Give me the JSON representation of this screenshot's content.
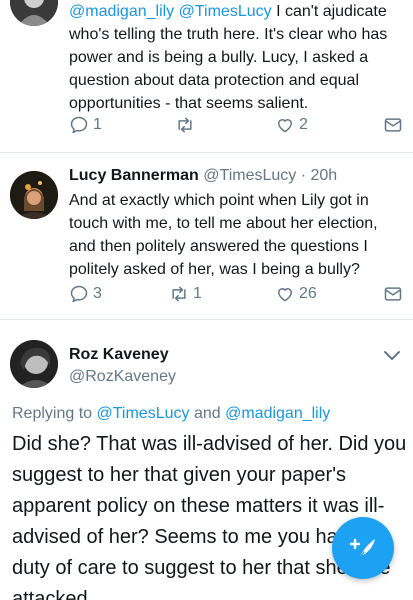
{
  "tweets": [
    {
      "mentions": "@madigan_lily @TimesLucy",
      "text": " I can't ajudicate who's telling the truth here. It's clear who has power and is being a bully. Lucy, I asked a question about data protection and equal opportunities - that seems salient.",
      "reply_count": "1",
      "retweet_count": "",
      "like_count": "2"
    },
    {
      "name": "Lucy Bannerman",
      "handle": "@TimesLucy",
      "separator": "·",
      "time": "20h",
      "text": "And at exactly which point when Lily got in touch with me, to tell me about her election, and then politely answered the questions I politely asked of her, was I being a bully?",
      "reply_count": "3",
      "retweet_count": "1",
      "like_count": "26"
    }
  ],
  "main_tweet": {
    "name": "Roz Kaveney",
    "handle": "@RozKaveney",
    "replying_prefix": "Replying to ",
    "replying_user1": "@TimesLucy",
    "replying_and": " and ",
    "replying_user2": "@madigan_lily",
    "text": "Did she? That was ill-advised of her. Did you suggest to her that given your paper's apparent policy on these matters it was ill-advised of her? Seems to me you had a duty of care to suggest to her that she'd be attacked."
  },
  "colors": {
    "accent": "#1da1f2",
    "link": "#1b95e0",
    "secondary_text": "#657786"
  },
  "icons": [
    "reply-icon",
    "retweet-icon",
    "like-icon",
    "dm-icon",
    "chevron-down-icon",
    "compose-icon"
  ]
}
